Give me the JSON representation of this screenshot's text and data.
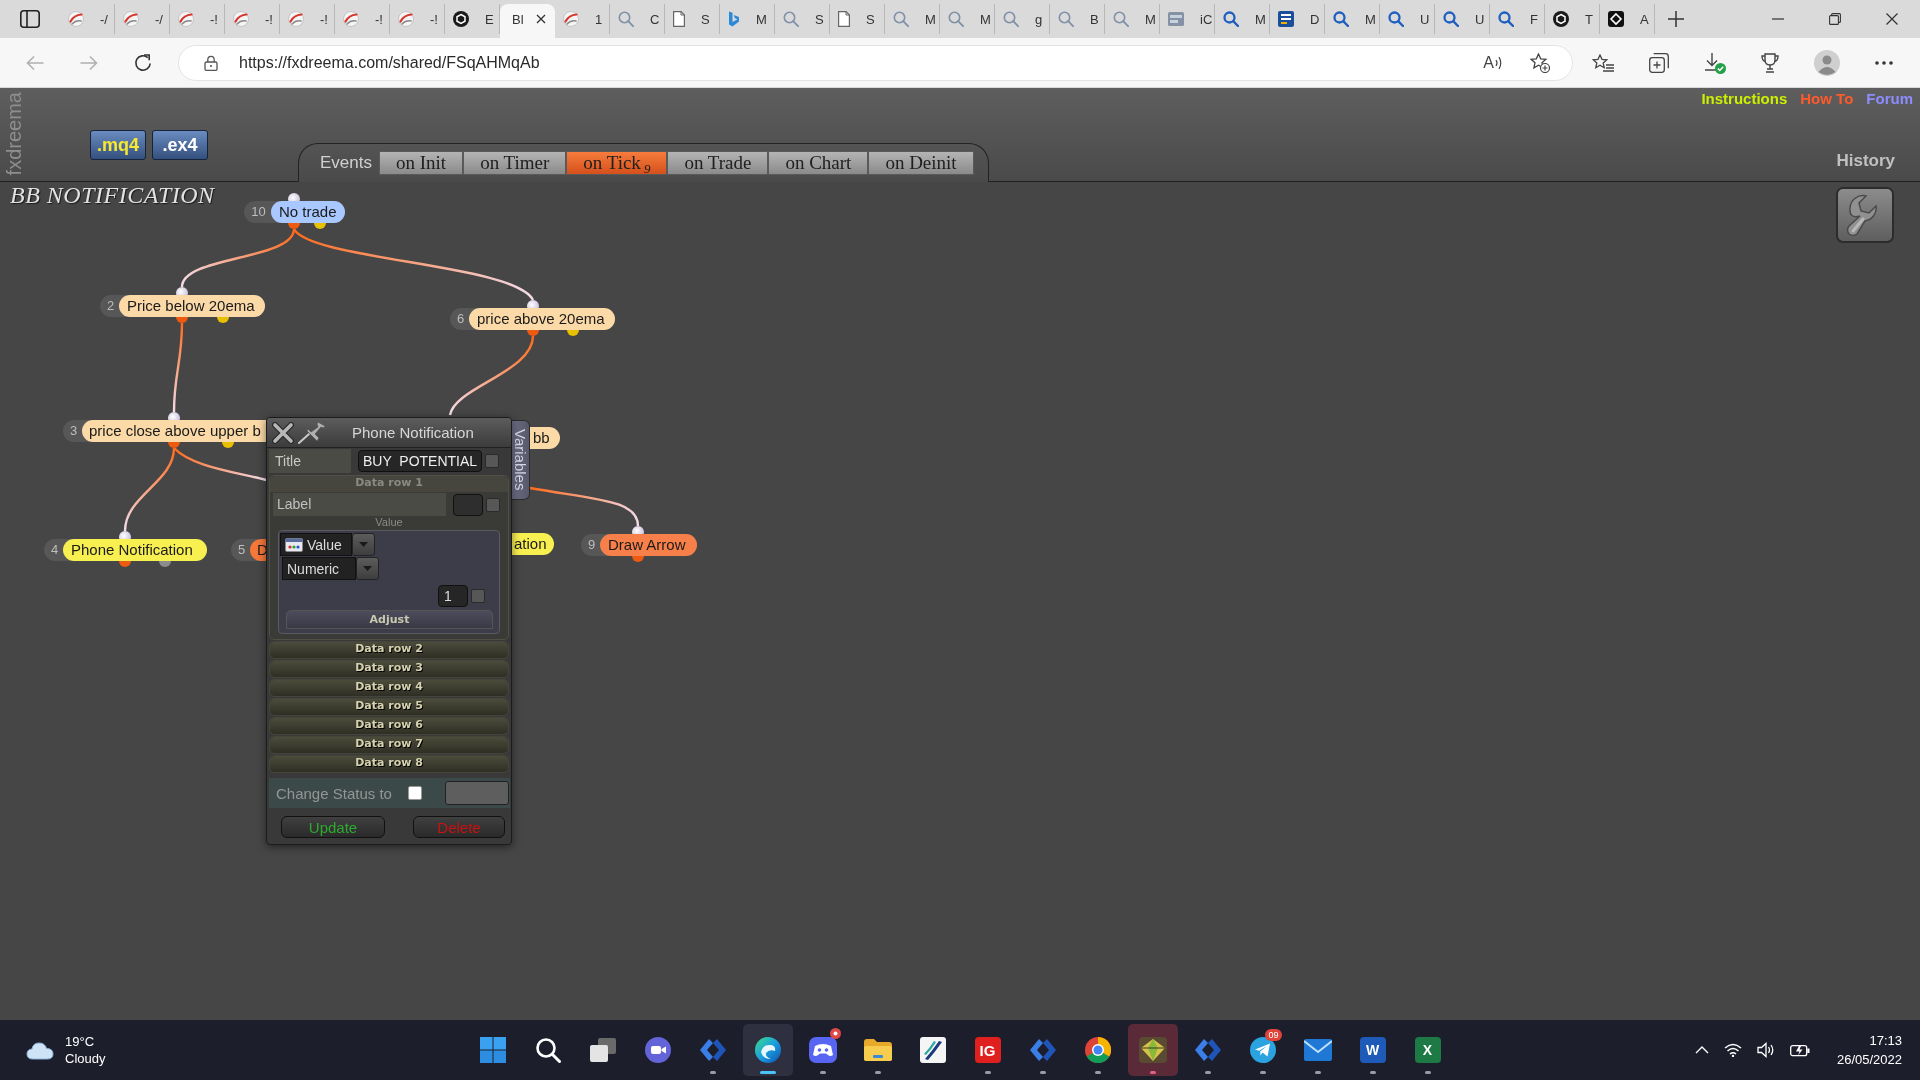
{
  "browser": {
    "tabs": [
      {
        "label": "-/",
        "kind": "swirl",
        "selected": false
      },
      {
        "label": "-/",
        "kind": "swirl",
        "selected": false
      },
      {
        "label": "-!",
        "kind": "swirl",
        "selected": false
      },
      {
        "label": "-!",
        "kind": "swirl",
        "selected": false
      },
      {
        "label": "-!",
        "kind": "swirl",
        "selected": false
      },
      {
        "label": "-!",
        "kind": "swirl",
        "selected": false
      },
      {
        "label": "-!",
        "kind": "swirl",
        "selected": false
      },
      {
        "label": "E",
        "kind": "hexagon",
        "selected": false
      },
      {
        "label": "Bl",
        "kind": "none",
        "selected": true
      },
      {
        "label": "1",
        "kind": "swirl",
        "selected": false
      },
      {
        "label": "C",
        "kind": "search",
        "selected": false
      },
      {
        "label": "S",
        "kind": "page",
        "selected": false
      },
      {
        "label": "M",
        "kind": "ribbon",
        "selected": false
      },
      {
        "label": "S",
        "kind": "search",
        "selected": false
      },
      {
        "label": "S",
        "kind": "page",
        "selected": false
      },
      {
        "label": "M",
        "kind": "search",
        "selected": false
      },
      {
        "label": "M",
        "kind": "search",
        "selected": false
      },
      {
        "label": "g",
        "kind": "search",
        "selected": false
      },
      {
        "label": "B",
        "kind": "search",
        "selected": false
      },
      {
        "label": "M",
        "kind": "search",
        "selected": false
      },
      {
        "label": "iC",
        "kind": "image",
        "selected": false
      },
      {
        "label": "M",
        "kind": "lens",
        "selected": false
      },
      {
        "label": "D",
        "kind": "tile",
        "selected": false
      },
      {
        "label": "M",
        "kind": "lens",
        "selected": false
      },
      {
        "label": "U",
        "kind": "lens",
        "selected": false
      },
      {
        "label": "U",
        "kind": "lens",
        "selected": false
      },
      {
        "label": "F",
        "kind": "lens",
        "selected": false
      },
      {
        "label": "T",
        "kind": "hexagon",
        "selected": false
      },
      {
        "label": "A",
        "kind": "diamond",
        "selected": false
      }
    ],
    "address": "https://fxdreema.com/shared/FSqAHMqAb",
    "read_aloud": "A"
  },
  "app": {
    "brand": "fxdreema",
    "files": [
      {
        "label": ".mq4",
        "color": "#f8e830"
      },
      {
        "label": ".ex4",
        "color": "#ffffff"
      }
    ],
    "events_label": "Events",
    "event_tabs": [
      {
        "label": "on Init",
        "selected": false
      },
      {
        "label": "on Timer",
        "selected": false
      },
      {
        "label": "on Tick",
        "count": "9",
        "selected": true
      },
      {
        "label": "on Trade",
        "selected": false
      },
      {
        "label": "on Chart",
        "selected": false
      },
      {
        "label": "on Deinit",
        "selected": false
      }
    ],
    "links": [
      {
        "label": "Instructions",
        "color": "#ccf000"
      },
      {
        "label": "How To",
        "color": "#ff5a2a"
      },
      {
        "label": "Forum",
        "color": "#8c8cff"
      }
    ],
    "history": "History",
    "project_title": "BB NOTIFICATION"
  },
  "canvas": {
    "nodes": [
      {
        "number": "10",
        "label": "No trade",
        "color": "#a9c8ff",
        "output_dots": [
          {
            "color": "#ee5a10"
          },
          {
            "color": "#e8c000"
          }
        ]
      },
      {
        "number": "2",
        "label": "Price below 20ema",
        "color": "#fcdaa8",
        "output_dots": [
          {
            "color": "#ee5a10"
          },
          {
            "color": "#e8c000"
          }
        ]
      },
      {
        "number": "6",
        "label": "price above 20ema",
        "color": "#fcdaa8",
        "output_dots": [
          {
            "color": "#ee5a10"
          },
          {
            "color": "#e8c000"
          }
        ]
      },
      {
        "number": "3",
        "label": "price close above upper b",
        "color": "#fcdaa8",
        "output_dots": [
          {
            "color": "#ee5a10"
          },
          {
            "color": "#e8c000"
          }
        ]
      },
      {
        "label": "bb",
        "color": "#fcdaa8"
      },
      {
        "number": "4",
        "label": "Phone Notification",
        "color": "#f8f050",
        "output_dots": [
          {
            "color": "#ee5a10"
          },
          {
            "color": "#8c8c8c"
          }
        ]
      },
      {
        "number": "5",
        "label": "D",
        "color": "#f5773a"
      },
      {
        "label": "ation",
        "color": "#f8f050"
      },
      {
        "number": "9",
        "label": "Draw Arrow",
        "color": "#f7804a",
        "output_dots": [
          {
            "color": "#ee5a10"
          }
        ]
      }
    ]
  },
  "dialog": {
    "title": "Phone Notification",
    "side_tab": "Variables",
    "title_field": {
      "label": "Title",
      "value": "BUY  POTENTIAL",
      "checked": false
    },
    "data_rows": [
      {
        "label": "Data row 1",
        "expanded": true,
        "field_label": "Label",
        "label_checked": false,
        "value_caption": "Value",
        "source": "Value",
        "format": "Numeric",
        "digits": "1",
        "digits_checked": false,
        "adjust": "Adjust"
      },
      {
        "label": "Data row 2",
        "expanded": false
      },
      {
        "label": "Data row 3",
        "expanded": false
      },
      {
        "label": "Data row 4",
        "expanded": false
      },
      {
        "label": "Data row 5",
        "expanded": false
      },
      {
        "label": "Data row 6",
        "expanded": false
      },
      {
        "label": "Data row 7",
        "expanded": false
      },
      {
        "label": "Data row 8",
        "expanded": false
      }
    ],
    "change_status": {
      "label": "Change Status to",
      "checked": false
    },
    "buttons": [
      {
        "label": "Update",
        "kind": "update"
      },
      {
        "label": "Delete",
        "kind": "delete"
      }
    ]
  },
  "taskbar": {
    "weather": {
      "temperature": "19°C",
      "condition": "Cloudy"
    },
    "apps": [
      {
        "kind": "windows",
        "running": false,
        "active": false,
        "flashing": false,
        "alert": false
      },
      {
        "kind": "search",
        "running": false,
        "active": false,
        "flashing": false,
        "alert": false
      },
      {
        "kind": "taskview",
        "running": false,
        "active": false,
        "flashing": false,
        "alert": false
      },
      {
        "kind": "meet",
        "running": false,
        "active": false,
        "flashing": false,
        "alert": false
      },
      {
        "kind": "chevron",
        "running": true,
        "active": false,
        "flashing": false,
        "alert": false
      },
      {
        "kind": "swirl",
        "running": true,
        "active": true,
        "flashing": false,
        "alert": false
      },
      {
        "kind": "gamepad",
        "running": true,
        "active": false,
        "flashing": false,
        "alert": true
      },
      {
        "kind": "folder",
        "running": true,
        "active": false,
        "flashing": false,
        "alert": false
      },
      {
        "kind": "slash",
        "running": false,
        "active": false,
        "flashing": false,
        "alert": false
      },
      {
        "kind": "letters",
        "label": "IG",
        "running": true,
        "active": false,
        "flashing": false,
        "alert": false
      },
      {
        "kind": "chevron",
        "running": true,
        "active": false,
        "flashing": false,
        "alert": false
      },
      {
        "kind": "ring",
        "running": true,
        "active": false,
        "flashing": false,
        "alert": false
      },
      {
        "kind": "gem",
        "running": true,
        "active": false,
        "flashing": true,
        "alert": false
      },
      {
        "kind": "chevron",
        "running": true,
        "active": false,
        "flashing": false,
        "alert": false
      },
      {
        "kind": "plane",
        "badge": "09",
        "running": true,
        "active": false,
        "flashing": false,
        "alert": false
      },
      {
        "kind": "mail",
        "running": true,
        "active": false,
        "flashing": false,
        "alert": false
      },
      {
        "kind": "word",
        "label": "W",
        "running": true,
        "active": false,
        "flashing": false,
        "alert": false
      },
      {
        "kind": "sheet",
        "label": "X",
        "running": true,
        "active": false,
        "flashing": false,
        "alert": false
      }
    ],
    "clock": {
      "time": "17:13",
      "date": "26/05/2022"
    }
  }
}
